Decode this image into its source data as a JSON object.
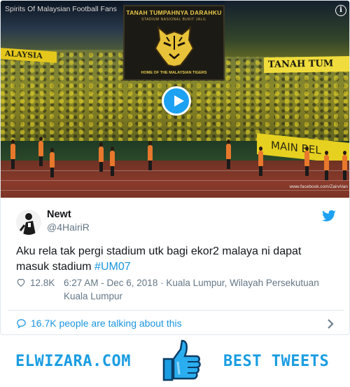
{
  "video": {
    "channel_name": "Spirits Of Malaysian Football Fans",
    "screen_title": "TANAH TUMPAHNYA DARAHKU",
    "screen_subtitle": "STADIUM NASIONAL BUKIT JALIL",
    "screen_footer": "HOME OF THE MALAYSIAN TIGERS",
    "banner_left": "ALAYSIA",
    "banner_right": "TANAH TUM",
    "banner_main": "MAIN BEL",
    "watermark": "www.facebook.com/ZainAlan",
    "info_glyph": "i",
    "play_icon": "play-icon",
    "accent_color": "#1da1f2"
  },
  "tweet": {
    "display_name": "Newt",
    "handle": "@4HairiR",
    "text_before": "Aku rela tak pergi stadium utk bagi ekor2 malaya ni dapat masuk stadium ",
    "hashtag": "#UM07",
    "likes": "12.8K",
    "time_location": "6:27 AM - Dec 6, 2018 · Kuala Lumpur, Wilayah Persekutuan Kuala Lumpur",
    "talking": "16.7K people are talking about this",
    "link_color": "#1b95e0"
  },
  "footer": {
    "brand": "ELWIZARA.COM",
    "tagline": "BEST TWEETS",
    "brand_color": "#1a9de2"
  }
}
